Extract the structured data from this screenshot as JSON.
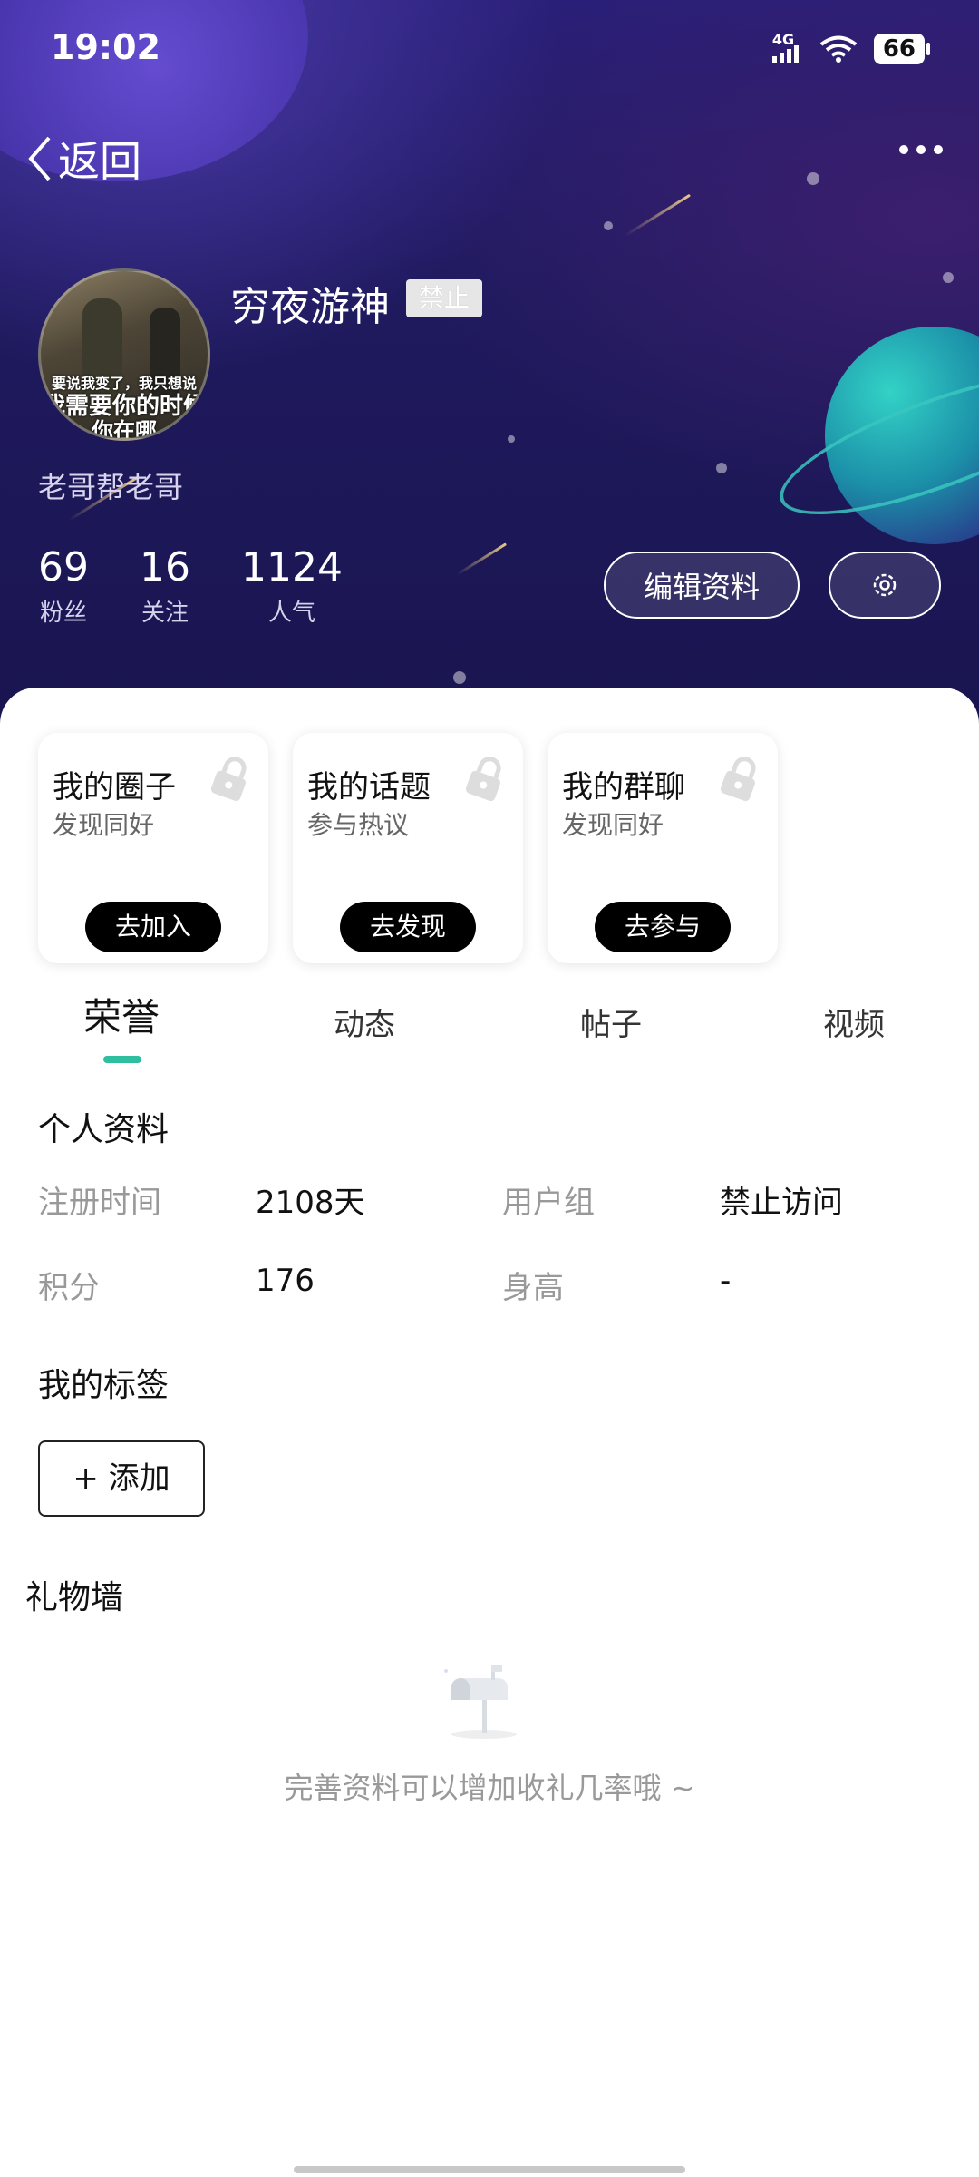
{
  "status_bar": {
    "time": "19:02",
    "network": "4G",
    "battery": "66"
  },
  "nav": {
    "back_label": "返回"
  },
  "profile": {
    "name": "穷夜游神",
    "badge": "禁止",
    "bio": "老哥帮老哥",
    "avatar_text": [
      "要说我变了，我只想说",
      "我需要你的时候",
      "你在哪"
    ]
  },
  "stats": [
    {
      "value": "69",
      "label": "粉丝"
    },
    {
      "value": "16",
      "label": "关注"
    },
    {
      "value": "1124",
      "label": "人气"
    }
  ],
  "actions": {
    "edit_label": "编辑资料"
  },
  "cards": [
    {
      "title": "我的圈子",
      "subtitle": "发现同好",
      "button": "去加入"
    },
    {
      "title": "我的话题",
      "subtitle": "参与热议",
      "button": "去发现"
    },
    {
      "title": "我的群聊",
      "subtitle": "发现同好",
      "button": "去参与"
    }
  ],
  "tabs": [
    "荣誉",
    "动态",
    "帖子",
    "视频"
  ],
  "personal_info": {
    "title": "个人资料",
    "rows": [
      {
        "label1": "注册时间",
        "value1": "2108天",
        "label2": "用户组",
        "value2": "禁止访问"
      },
      {
        "label1": "积分",
        "value1": "176",
        "label2": "身高",
        "value2": "-"
      }
    ]
  },
  "tags": {
    "title": "我的标签",
    "add_label": "+ 添加"
  },
  "gift_wall": {
    "title": "礼物墙",
    "empty_text": "完善资料可以增加收礼几率哦 ~"
  },
  "colors": {
    "accent": "#2fbfa0",
    "hero_bg": "#1f1a5e"
  }
}
